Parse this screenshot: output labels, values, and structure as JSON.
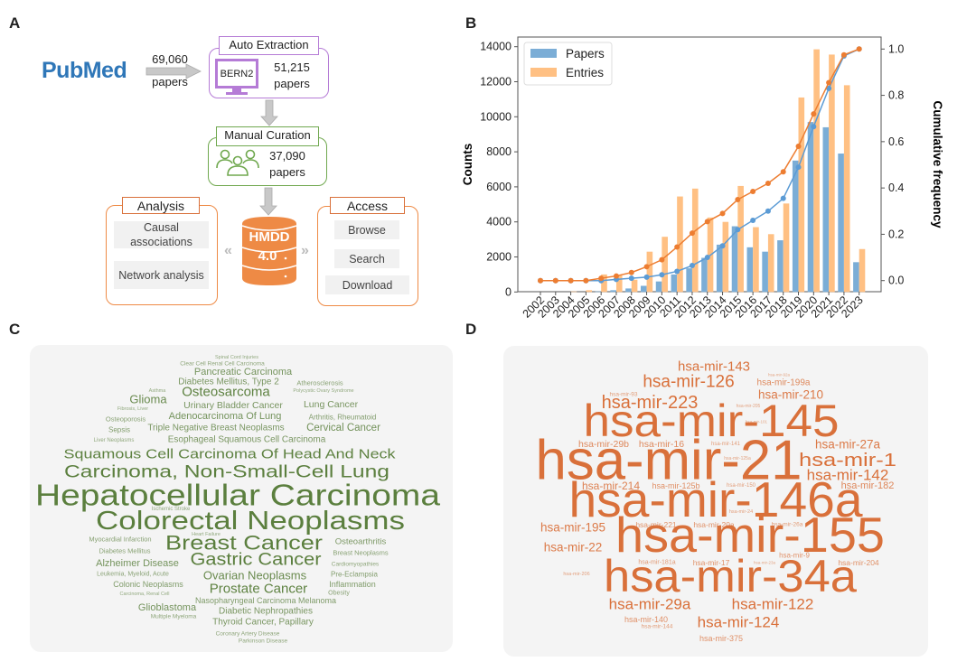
{
  "panel_labels": {
    "a": "A",
    "b": "B",
    "c": "C",
    "d": "D"
  },
  "panel_a": {
    "pubmed_logo": "PubMed",
    "pubmed_count": "69,060",
    "pubmed_unit": "papers",
    "auto_extraction": {
      "title": "Auto Extraction",
      "tool": "BERN2",
      "count": "51,215",
      "unit": "papers"
    },
    "manual_curation": {
      "title": "Manual Curation",
      "count": "37,090",
      "unit": "papers"
    },
    "database": {
      "name": "HMDD",
      "version": "4.0"
    },
    "analysis": {
      "title": "Analysis",
      "items": [
        "Causal associations",
        "Network analysis"
      ]
    },
    "access": {
      "title": "Access",
      "items": [
        "Browse",
        "Search",
        "Download"
      ]
    },
    "colors": {
      "purple": "#b57bd6",
      "green": "#70a84f",
      "orange": "#ee8a45",
      "arrow": "#c8c8c8"
    }
  },
  "chart_data": {
    "type": "bar+line",
    "categories": [
      "2002",
      "2003",
      "2004",
      "2005",
      "2006",
      "2007",
      "2008",
      "2009",
      "2010",
      "2011",
      "2012",
      "2013",
      "2014",
      "2015",
      "2016",
      "2017",
      "2018",
      "2019",
      "2020",
      "2021",
      "2022",
      "2023"
    ],
    "series": [
      {
        "name": "Papers",
        "type": "bar",
        "axis": "left",
        "color": "#7badd6",
        "values": [
          0,
          0,
          0,
          0,
          30,
          100,
          200,
          350,
          600,
          1000,
          1350,
          1950,
          2700,
          3750,
          2550,
          2300,
          2950,
          7500,
          9700,
          9400,
          7900,
          1700
        ]
      },
      {
        "name": "Entries",
        "type": "bar",
        "axis": "left",
        "color": "#ffc083",
        "values": [
          0,
          0,
          30,
          100,
          1000,
          950,
          700,
          2300,
          3150,
          5450,
          5900,
          4250,
          4000,
          6050,
          3700,
          3300,
          5050,
          11100,
          13850,
          13550,
          11800,
          2450
        ]
      },
      {
        "type": "line",
        "axis": "right",
        "color": "#5b9bd5",
        "values": [
          0,
          0,
          0,
          0,
          0.0,
          0.005,
          0.01,
          0.015,
          0.025,
          0.04,
          0.065,
          0.1,
          0.15,
          0.22,
          0.26,
          0.3,
          0.355,
          0.49,
          0.665,
          0.83,
          0.97,
          1.0
        ]
      },
      {
        "type": "line",
        "axis": "right",
        "color": "#ed7d31",
        "values": [
          0,
          0,
          0,
          0,
          0.01,
          0.02,
          0.035,
          0.06,
          0.09,
          0.145,
          0.205,
          0.255,
          0.29,
          0.35,
          0.385,
          0.42,
          0.47,
          0.58,
          0.72,
          0.855,
          0.975,
          1.0
        ]
      }
    ],
    "ylabel": "Counts",
    "y2label": "Cumulative frequency",
    "ylim": [
      0,
      14000
    ],
    "y2lim": [
      -0.05,
      1.05
    ],
    "yticks": [
      "0",
      "2000",
      "4000",
      "6000",
      "8000",
      "10000",
      "12000",
      "14000"
    ],
    "y2ticks": [
      "0.0",
      "0.2",
      "0.4",
      "0.6",
      "0.8",
      "1.0"
    ],
    "grid": false,
    "legend": "top-left"
  },
  "panel_c": {
    "color": "#5b7f3e",
    "words": [
      "Spinal Cord Injuries",
      "Clear Cell Renal Cell Carcinoma",
      "Pancreatic Carcinoma",
      "Diabetes Mellitus, Type 2",
      "Atherosclerosis",
      "Asthma",
      "Osteosarcoma",
      "Polycystic Ovary Syndrome",
      "Glioma",
      "Fibrosis, Liver",
      "Urinary Bladder Cancer",
      "Lung Cancer",
      "Osteoporosis",
      "Adenocarcinoma Of Lung",
      "Arthritis, Rheumatoid",
      "Sepsis",
      "Triple Negative Breast Neoplasms",
      "Cervical Cancer",
      "Liver Neoplasms",
      "Esophageal Squamous Cell Carcinoma",
      "Squamous Cell Carcinoma Of Head And Neck",
      "Carcinoma, Non-Small-Cell Lung",
      "Hepatocellular Carcinoma",
      "Ischemic Stroke",
      "Colorectal Neoplasms",
      "Heart Failure",
      "Myocardial Infarction",
      "Breast Cancer",
      "Osteoarthritis",
      "Diabetes Mellitus",
      "Breast Neoplasms",
      "Alzheimer Disease",
      "Gastric Cancer",
      "Cardiomyopathies",
      "Leukemia, Myeloid, Acute",
      "Ovarian Neoplasms",
      "Pre-Eclampsia",
      "Colonic Neoplasms",
      "Inflammation",
      "Prostate Cancer",
      "Carcinoma, Renal Cell",
      "Obesity",
      "Nasopharyngeal Carcinoma Melanoma",
      "Glioblastoma",
      "Diabetic Nephropathies",
      "Multiple Myeloma",
      "Thyroid Cancer, Papillary",
      "Coronary Artery Disease",
      "Parkinson Disease"
    ]
  },
  "panel_d": {
    "color": "#d9703a",
    "words": [
      "hsa-mir-143",
      "hsa-mir-92a",
      "hsa-mir-126",
      "hsa-mir-199a",
      "hsa-mir-93",
      "hsa-mir-210",
      "hsa-mir-223",
      "hsa-mir-205",
      "hsa-mir-145",
      "hsa-mir-101",
      "hsa-mir-29b",
      "hsa-mir-16",
      "hsa-mir-141",
      "hsa-mir-27a",
      "hsa-mir-21",
      "hsa-mir-1",
      "hsa-mir-125a",
      "hsa-mir-142",
      "hsa-mir-214",
      "hsa-mir-125b",
      "hsa-mir-150",
      "hsa-mir-182",
      "hsa-mir-146a",
      "hsa-mir-24",
      "hsa-mir-195",
      "hsa-mir-221",
      "hsa-mir-20a",
      "hsa-mir-26a",
      "hsa-mir-155",
      "hsa-mir-22",
      "hsa-mir-9",
      "hsa-mir-181a",
      "hsa-mir-17",
      "hsa-mir-23a",
      "hsa-mir-204",
      "hsa-mir-206",
      "hsa-mir-34a",
      "hsa-mir-29a",
      "hsa-mir-122",
      "hsa-mir-140",
      "hsa-mir-124",
      "hsa-mir-144",
      "hsa-mir-375"
    ]
  }
}
